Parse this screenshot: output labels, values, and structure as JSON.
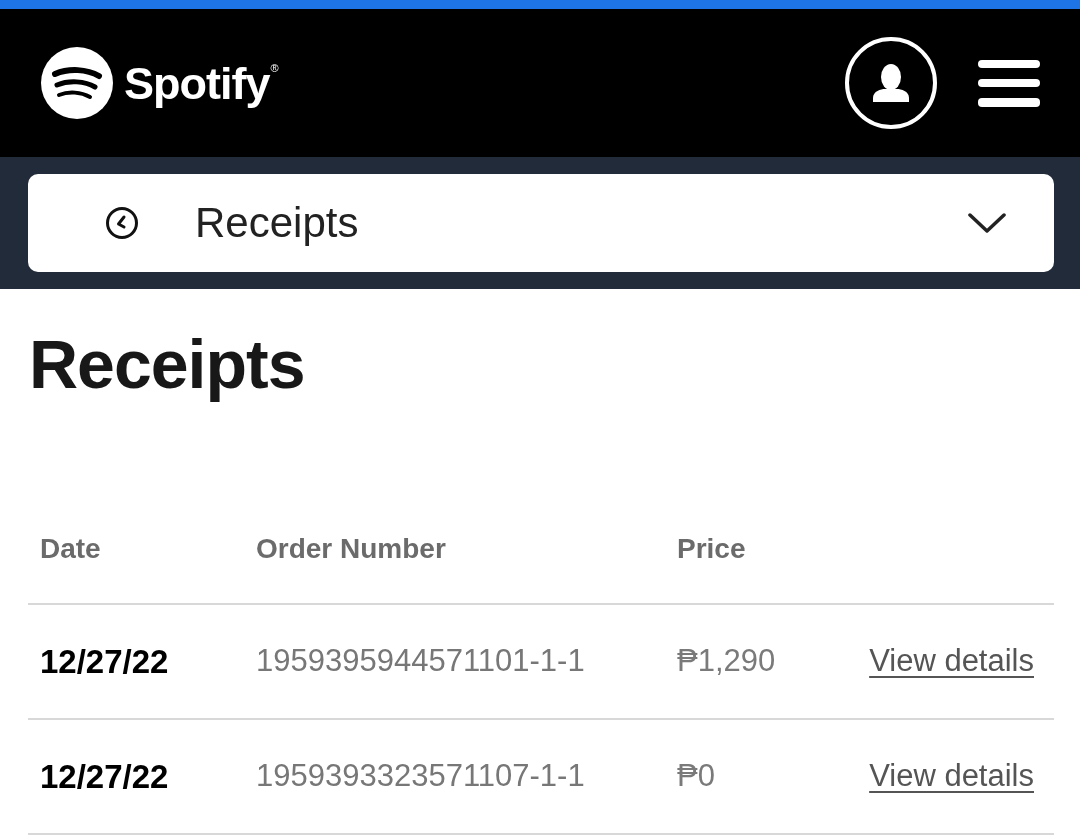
{
  "header": {
    "logo_text": "Spotify",
    "logo_mark": "®"
  },
  "section_select": {
    "label": "Receipts"
  },
  "page": {
    "title": "Receipts"
  },
  "table": {
    "columns": [
      "Date",
      "Order Number",
      "Price"
    ],
    "rows": [
      {
        "date": "12/27/22",
        "order_number": "1959395944571101-1-1",
        "price": "₱1,290",
        "link": "View details"
      },
      {
        "date": "12/27/22",
        "order_number": "1959393323571107-1-1",
        "price": "₱0",
        "link": "View details"
      }
    ]
  }
}
